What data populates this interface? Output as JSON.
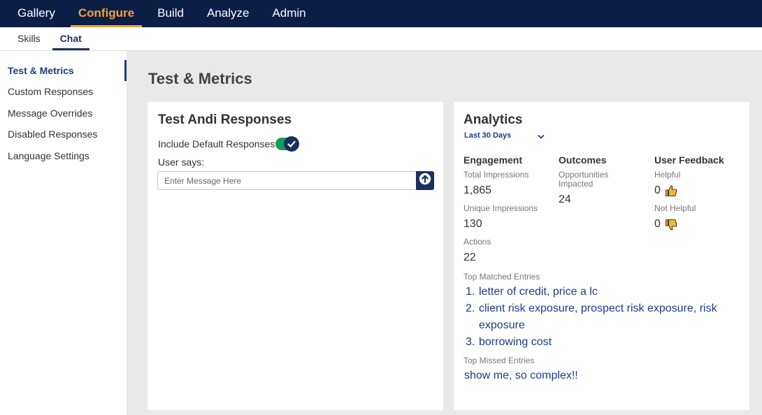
{
  "top_nav": {
    "tabs": [
      {
        "label": "Gallery"
      },
      {
        "label": "Configure"
      },
      {
        "label": "Build"
      },
      {
        "label": "Analyze"
      },
      {
        "label": "Admin"
      }
    ],
    "active": "Configure"
  },
  "sub_nav": {
    "tabs": [
      {
        "label": "Skills"
      },
      {
        "label": "Chat"
      }
    ],
    "active": "Chat"
  },
  "sidebar": {
    "items": [
      {
        "label": "Test & Metrics"
      },
      {
        "label": "Custom Responses"
      },
      {
        "label": "Message Overrides"
      },
      {
        "label": "Disabled Responses"
      },
      {
        "label": "Language Settings"
      }
    ],
    "active": "Test & Metrics"
  },
  "page_title": "Test & Metrics",
  "test_card": {
    "title": "Test Andi Responses",
    "toggle_label": "Include Default Responses",
    "toggle_on": true,
    "user_says_label": "User says:",
    "input_placeholder": "Enter Message Here",
    "input_value": "",
    "send_icon": "arrow-up-circle-icon"
  },
  "analytics": {
    "title": "Analytics",
    "date_range": "Last 30 Days",
    "engagement": {
      "heading": "Engagement",
      "total_impressions_label": "Total Impressions",
      "total_impressions_value": "1,865",
      "unique_impressions_label": "Unique Impressions",
      "unique_impressions_value": "130",
      "actions_label": "Actions",
      "actions_value": "22"
    },
    "outcomes": {
      "heading": "Outcomes",
      "opportunities_label_line1": "Opportunities",
      "opportunities_label_line2": "Impacted",
      "opportunities_value": "24"
    },
    "feedback": {
      "heading": "User Feedback",
      "helpful_label": "Helpful",
      "helpful_value": "0",
      "not_helpful_label": "Not Helpful",
      "not_helpful_value": "0",
      "thumb_color": "#f5b731"
    },
    "top_matched_label": "Top Matched Entries",
    "top_matched": [
      {
        "num": "1.",
        "text": "letter of credit, price a lc"
      },
      {
        "num": "2.",
        "text": "client risk exposure, prospect risk exposure, risk exposure"
      },
      {
        "num": "3.",
        "text": "borrowing cost"
      }
    ],
    "top_missed_label": "Top Missed Entries",
    "top_missed": "show me, so complex!!"
  },
  "colors": {
    "nav_bg": "#0b1e46",
    "accent_orange": "#f5a02a",
    "primary_navy": "#1b2f5e",
    "link_blue": "#1b3d8a",
    "toggle_green": "#1a9a5a"
  }
}
